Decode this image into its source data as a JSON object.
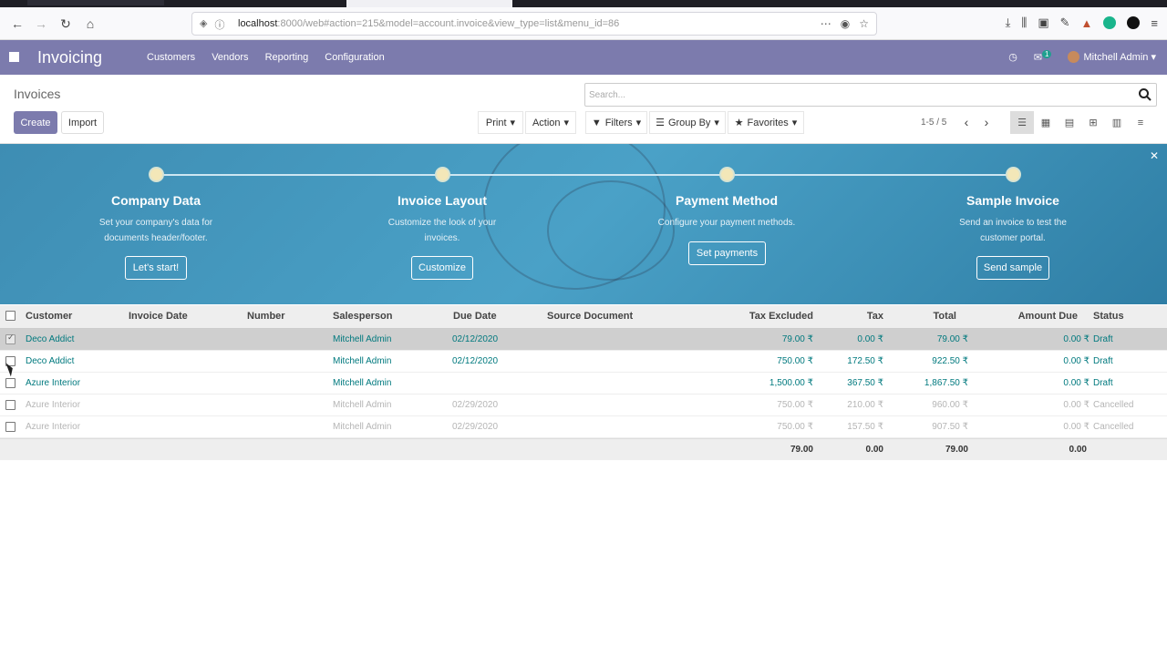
{
  "browser": {
    "url_host": "localhost",
    "url_rest": ":8000/web#action=215&model=account.invoice&view_type=list&menu_id=86"
  },
  "app": {
    "name": "Invoicing",
    "menus": [
      "Customers",
      "Vendors",
      "Reporting",
      "Configuration"
    ],
    "user": "Mitchell Admin",
    "messages_badge": "1"
  },
  "control": {
    "breadcrumb": "Invoices",
    "create": "Create",
    "import": "Import",
    "search_placeholder": "Search...",
    "print": "Print",
    "action": "Action",
    "filters": "Filters",
    "group_by": "Group By",
    "favorites": "Favorites",
    "pager": "1-5 / 5"
  },
  "onboarding": {
    "steps": [
      {
        "title": "Company Data",
        "desc": "Set your company's data for documents header/footer.",
        "button": "Let's start!"
      },
      {
        "title": "Invoice Layout",
        "desc": "Customize the look of your invoices.",
        "button": "Customize"
      },
      {
        "title": "Payment Method",
        "desc": "Configure your payment methods.",
        "button": "Set payments"
      },
      {
        "title": "Sample Invoice",
        "desc": "Send an invoice to test the customer portal.",
        "button": "Send sample"
      }
    ]
  },
  "table": {
    "columns": [
      "Customer",
      "Invoice Date",
      "Number",
      "Salesperson",
      "Due Date",
      "Source Document",
      "Tax Excluded",
      "Tax",
      "Total",
      "Amount Due",
      "Status"
    ],
    "rows": [
      {
        "customer": "Deco Addict",
        "salesperson": "Mitchell Admin",
        "due": "02/12/2020",
        "tax_excl": "79.00 ₹",
        "tax": "0.00 ₹",
        "total": "79.00 ₹",
        "due_amt": "0.00 ₹",
        "status": "Draft"
      },
      {
        "customer": "Deco Addict",
        "salesperson": "Mitchell Admin",
        "due": "02/12/2020",
        "tax_excl": "750.00 ₹",
        "tax": "172.50 ₹",
        "total": "922.50 ₹",
        "due_amt": "0.00 ₹",
        "status": "Draft"
      },
      {
        "customer": "Azure Interior",
        "salesperson": "Mitchell Admin",
        "due": "",
        "tax_excl": "1,500.00 ₹",
        "tax": "367.50 ₹",
        "total": "1,867.50 ₹",
        "due_amt": "0.00 ₹",
        "status": "Draft"
      },
      {
        "customer": "Azure Interior",
        "salesperson": "Mitchell Admin",
        "due": "02/29/2020",
        "tax_excl": "750.00 ₹",
        "tax": "210.00 ₹",
        "total": "960.00 ₹",
        "due_amt": "0.00 ₹",
        "status": "Cancelled"
      },
      {
        "customer": "Azure Interior",
        "salesperson": "Mitchell Admin",
        "due": "02/29/2020",
        "tax_excl": "750.00 ₹",
        "tax": "157.50 ₹",
        "total": "907.50 ₹",
        "due_amt": "0.00 ₹",
        "status": "Cancelled"
      }
    ],
    "totals": {
      "tax_excl": "79.00",
      "tax": "0.00",
      "total": "79.00",
      "due_amt": "0.00"
    }
  },
  "colors": {
    "brand": "#7c7bad",
    "link": "#00797e",
    "banner": "#4aa1c7"
  }
}
